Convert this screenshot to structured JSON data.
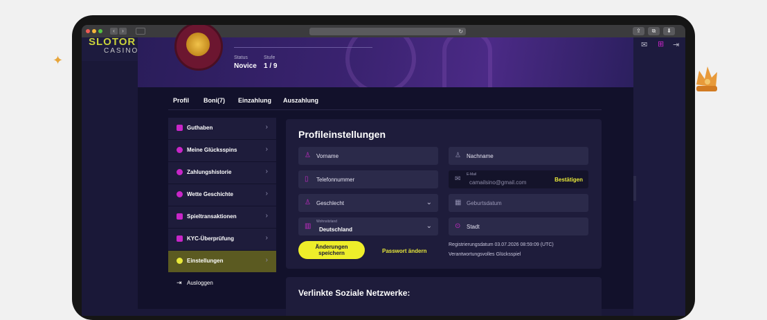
{
  "decor": {
    "sparkle": "✦"
  },
  "browser": {
    "back": "‹",
    "forward": "›",
    "reload": "↻"
  },
  "site": {
    "logo_top": "SLOTOR",
    "logo_bottom": "CASINO"
  },
  "header_icons": [
    "mail-icon",
    "gift-icon",
    "logout-icon"
  ],
  "profile": {
    "status_label": "Status",
    "status_value": "Novice",
    "level_label": "Stufe",
    "level_value": "1 / 9"
  },
  "tabs": [
    {
      "label": "Profil"
    },
    {
      "label": "Boni(7)"
    },
    {
      "label": "Einzahlung"
    },
    {
      "label": "Auszahlung"
    }
  ],
  "sidebar": {
    "items": [
      {
        "label": "Guthaben"
      },
      {
        "label": "Meine Glücksspins"
      },
      {
        "label": "Zahlungshistorie"
      },
      {
        "label": "Wette Geschichte"
      },
      {
        "label": "Spieltransaktionen"
      },
      {
        "label": "KYC-Überprüfung"
      },
      {
        "label": "Einstellungen"
      },
      {
        "label": "Ausloggen"
      }
    ]
  },
  "settings": {
    "title": "Profileinstellungen",
    "first_name_placeholder": "Vorname",
    "last_name_placeholder": "Nachname",
    "phone_placeholder": "Telefonnummer",
    "email_label": "E-Mail",
    "email_value": "camailsino@gmail.com",
    "confirm_label": "Bestätigen",
    "gender_placeholder": "Geschlecht",
    "birthdate_placeholder": "Geburtsdatum",
    "country_label": "Wohnsitzland",
    "country_value": "Deutschland",
    "city_placeholder": "Stadt",
    "save_label_line1": "Änderungen",
    "save_label_line2": "speichern",
    "password_link": "Passwort ändern",
    "registration_info": "Registrierungsdatum 03.07.2026 08:59:09 (UTC)",
    "responsible_gaming": "Verantwortungsvolles Glücksspiel"
  },
  "social": {
    "title": "Verlinkte Soziale Netzwerke:"
  },
  "colors": {
    "accent_yellow": "#eeee2a",
    "accent_magenta": "#c826c8",
    "panel_bg": "#1e1c3b",
    "page_bg": "#12112b"
  }
}
